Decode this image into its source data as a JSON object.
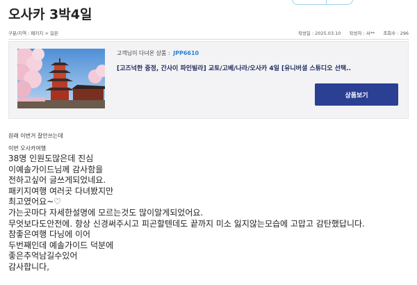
{
  "page": {
    "title": "오사카 3박4일",
    "breadcrumb": "구분/지역 : 패키지 > 일본",
    "meta": {
      "date": "작성일 : 2025.03.10",
      "author": "작성자 : 서**",
      "views": "조회수 : 296"
    }
  },
  "product": {
    "visit_label": "고객님이 다녀온 상품 :",
    "code": "JPP6610",
    "name": "[고즈넉한 중정, 간사이 파인빌라] 교토/고베/나라/오사카 4일 [유니버셜 스튜디오 선택..",
    "button_label": "상품보기",
    "thumbnail_icon": "pagoda-cherry-blossom-photo"
  },
  "review": {
    "pre_lines": [
      "원래 이번거 잘안쓰는데",
      "이번 오사카여행"
    ],
    "lines": [
      "38명 인원도많은데 진심",
      "이예솔가이드님께 감사함을",
      "전하고싶어 글쓰게되었네요.",
      "패키지여행 여러곳 다녀봤지만",
      "최고였어요~♡",
      "가는곳마다 자세한설명에 모르는것도 많이알게되었어요.",
      "무엇보다도안전에. 항상 신경써주시고 피곤할텐데도 끝까지 미소 잃지않는모습에 고맙고 감탄했답니다.",
      "참좋은여행 다닝에 이어",
      "두번째인데 예솔가이드 덕분에",
      "좋은추억남길수있어",
      "감사합니다,"
    ]
  },
  "colors": {
    "accent": "#2b3f93",
    "code": "#2d7fd2",
    "card_bg": "#f3f3f5"
  }
}
